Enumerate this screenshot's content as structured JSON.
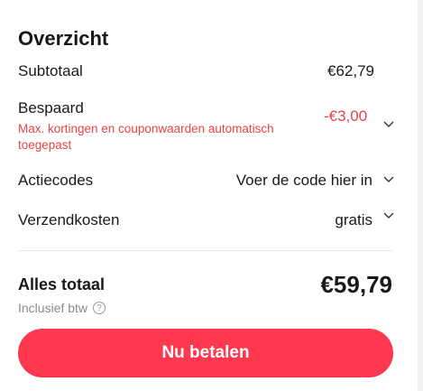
{
  "summary": {
    "title": "Overzicht",
    "subtotal_label": "Subtotaal",
    "subtotal_value": "€62,79",
    "saved_label": "Bespaard",
    "saved_note": "Max. kortingen en couponwaarden automatisch toegepast",
    "saved_value": "-€3,00",
    "promo_label": "Actiecodes",
    "promo_value": "Voer de code hier in",
    "shipping_label": "Verzendkosten",
    "shipping_value": "gratis",
    "total_label": "Alles totaal",
    "total_value": "€59,79",
    "vat_note": "Inclusief btw",
    "help_glyph": "?",
    "pay_button_label": "Nu betalen"
  },
  "icons": {
    "saved_toggle": "chevron-down-icon",
    "promo_toggle": "chevron-down-icon",
    "shipping_toggle": "chevron-down-icon",
    "vat_help": "question-circle-icon"
  },
  "colors": {
    "accent": "#fd384f",
    "discount": "#e64545",
    "muted": "#8a8a8a"
  }
}
